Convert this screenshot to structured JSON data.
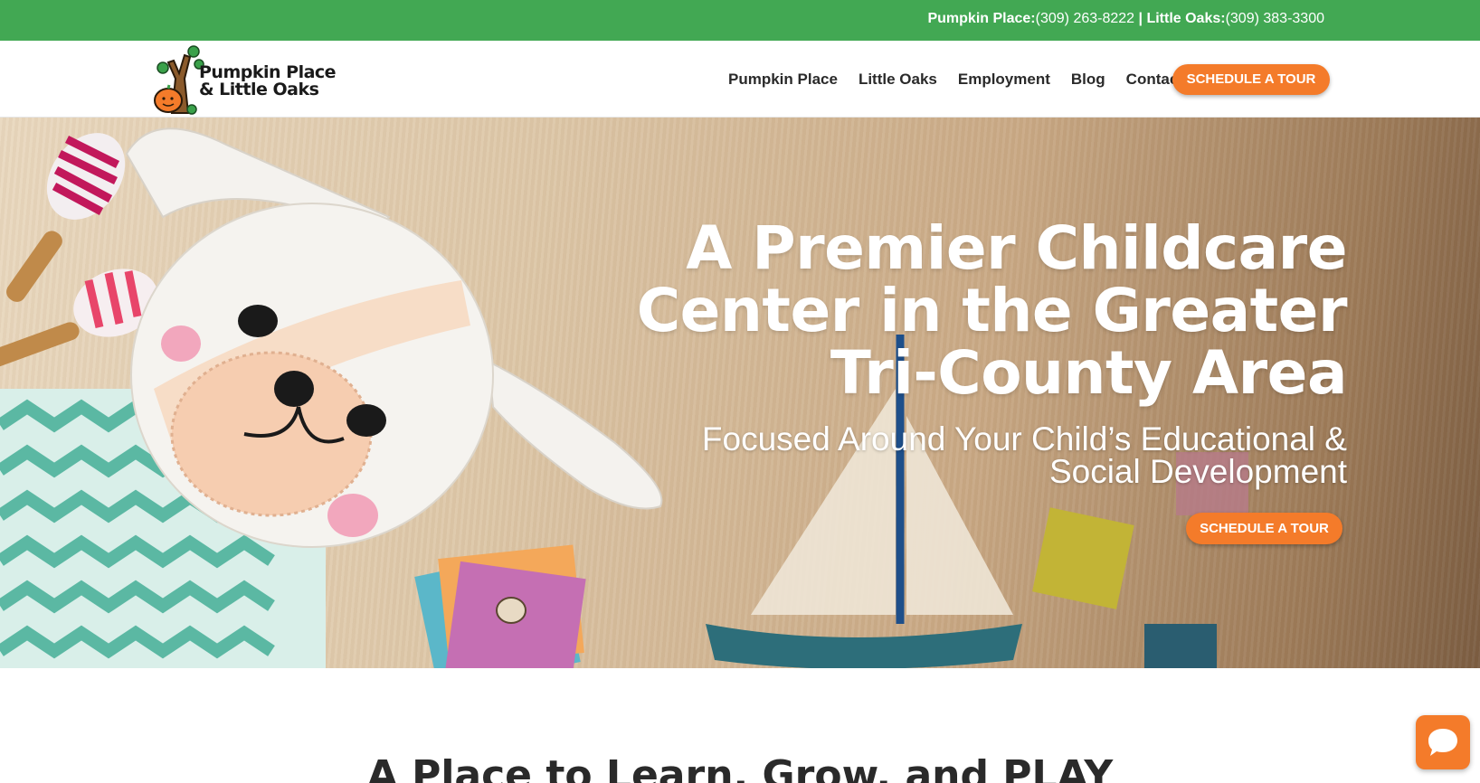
{
  "topbar": {
    "location1_label": "Pumpkin Place:",
    "location1_phone": "(309) 263-8222",
    "separator": " | ",
    "location2_label": "Little Oaks:",
    "location2_phone": "(309) 383-3300"
  },
  "logo": {
    "line1": "Pumpkin Place",
    "line2": "& Little Oaks"
  },
  "nav": {
    "items": [
      {
        "label": "Pumpkin Place"
      },
      {
        "label": "Little Oaks"
      },
      {
        "label": "Employment"
      },
      {
        "label": "Blog"
      },
      {
        "label": "Contact"
      }
    ],
    "cta_label": "SCHEDULE A TOUR"
  },
  "hero": {
    "title_line1": "A Premier Childcare",
    "title_line2": "Center in the Greater",
    "title_line3": "Tri-County Area",
    "subtitle_line1": "Focused Around Your Child’s Educational &",
    "subtitle_line2": "Social Development",
    "cta_label": "SCHEDULE A TOUR"
  },
  "section": {
    "title": "A Place to Learn, Grow, and PLAY"
  },
  "colors": {
    "brand_green": "#42a853",
    "accent_orange": "#f47b2a"
  },
  "icons": {
    "chat": "chat-bubble-icon",
    "logo": "tree-pumpkin-logo"
  }
}
